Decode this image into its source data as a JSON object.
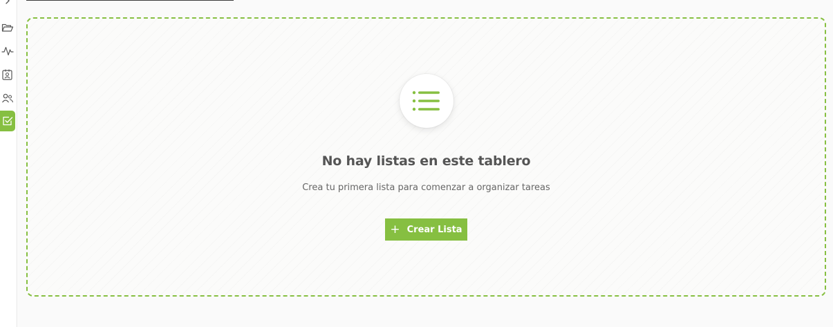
{
  "sidebar": {
    "items": [
      {
        "icon": "chevron-right-icon"
      },
      {
        "icon": "folder-open-icon"
      },
      {
        "icon": "activity-icon"
      },
      {
        "icon": "contact-card-icon"
      },
      {
        "icon": "users-icon"
      },
      {
        "icon": "checkbox-icon",
        "active": true
      }
    ]
  },
  "empty_state": {
    "icon": "list-icon",
    "title": "No hay listas en este tablero",
    "subtitle": "Crea tu primera lista para comenzar a organizar tareas",
    "button_icon": "+",
    "button_label": "Crear Lista"
  },
  "colors": {
    "accent": "#86bf41",
    "background": "#fafafa",
    "text": "#555555"
  }
}
